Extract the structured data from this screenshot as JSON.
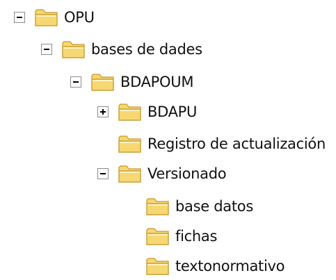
{
  "tree": {
    "nodes": [
      {
        "label": "OPU",
        "state": "expanded",
        "icon": "folder-icon"
      },
      {
        "label": "bases de dades",
        "state": "expanded",
        "icon": "folder-icon"
      },
      {
        "label": "BDAPOUM",
        "state": "expanded",
        "icon": "folder-icon"
      },
      {
        "label": "BDAPU",
        "state": "collapsed",
        "icon": "folder-icon"
      },
      {
        "label": "Registro de actualización",
        "state": "leaf",
        "icon": "folder-icon"
      },
      {
        "label": "Versionado",
        "state": "expanded",
        "icon": "folder-icon"
      },
      {
        "label": "base datos",
        "state": "leaf",
        "icon": "folder-icon"
      },
      {
        "label": "fichas",
        "state": "leaf",
        "icon": "folder-icon"
      },
      {
        "label": "textonormativo",
        "state": "leaf",
        "icon": "folder-icon"
      }
    ]
  },
  "colors": {
    "folder_fill": "#f6d873",
    "folder_dark": "#c9962a",
    "folder_light": "#fdf3c4",
    "toggle_border": "#8c8c8c",
    "text": "#111111"
  }
}
